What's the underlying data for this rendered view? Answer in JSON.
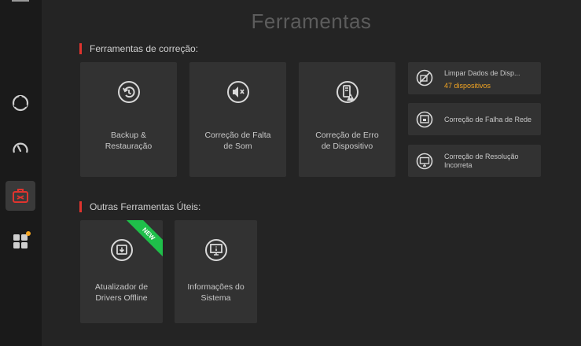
{
  "page_title": "Ferramentas",
  "sections": {
    "fix_tools": "Ferramentas de correção:",
    "other_tools": "Outras Ferramentas Úteis:"
  },
  "fix_cards": [
    {
      "label": "Backup &\nRestauração",
      "icon": "backup-restore-icon"
    },
    {
      "label": "Correção de Falta\nde Som",
      "icon": "speaker-mute-icon"
    },
    {
      "label": "Correção de Erro\nde Dispositivo",
      "icon": "device-warning-icon"
    }
  ],
  "side_cards": [
    {
      "label": "Limpar Dados de Disp...",
      "sub": "47 dispositivos",
      "icon": "device-clean-icon"
    },
    {
      "label": "Correção de Falha de Rede",
      "icon": "network-icon"
    },
    {
      "label": "Correção de Resolução\nIncorreta",
      "icon": "monitor-resolution-icon"
    }
  ],
  "other_cards": [
    {
      "label": "Atualizador de\nDrivers Offline",
      "icon": "offline-driver-icon",
      "badge": "NEW"
    },
    {
      "label": "Informações do\nSistema",
      "icon": "system-info-icon"
    }
  ],
  "sidebar": [
    {
      "icon": "scan-icon"
    },
    {
      "icon": "speedometer-icon"
    },
    {
      "icon": "toolbox-icon",
      "active": true
    },
    {
      "icon": "apps-icon",
      "dot": true
    }
  ],
  "colors": {
    "accent": "#e0342e",
    "badge": "#f5a623",
    "new": "#1fbf4a"
  }
}
